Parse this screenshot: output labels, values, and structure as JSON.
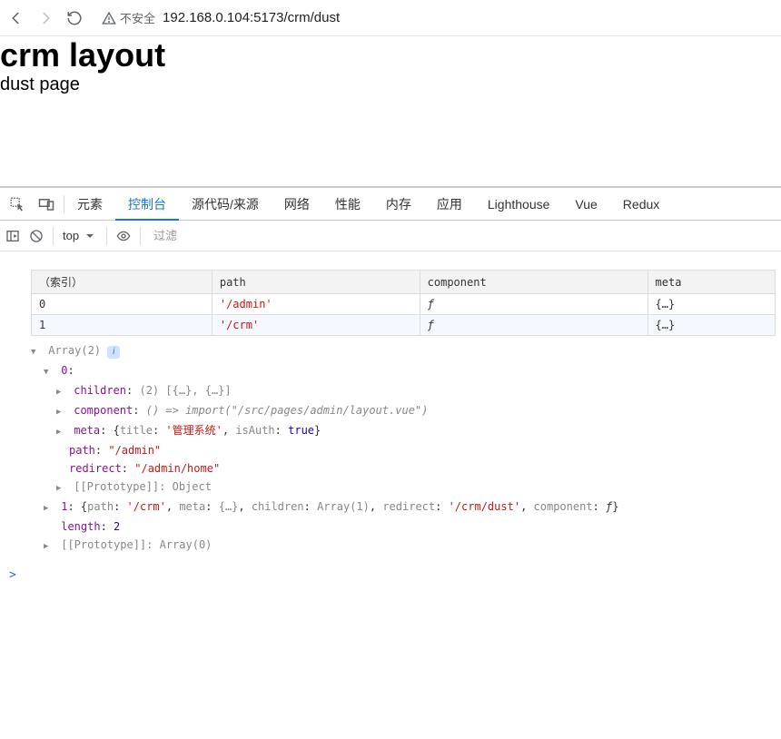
{
  "browser": {
    "not_secure_label": "不安全",
    "url": "192.168.0.104:5173/crm/dust"
  },
  "page": {
    "heading": "crm layout",
    "sub": "dust page"
  },
  "devtools": {
    "tabs": [
      "元素",
      "控制台",
      "源代码/来源",
      "网络",
      "性能",
      "内存",
      "应用",
      "Lighthouse",
      "Vue",
      "Redux"
    ],
    "active_tab_index": 1,
    "context": "top",
    "filter_placeholder": "过滤"
  },
  "table": {
    "headers": [
      "（索引）",
      "path",
      "component",
      "meta"
    ],
    "rows": [
      {
        "index": "0",
        "path": "'/admin'",
        "component": "ƒ",
        "meta": "{…}"
      },
      {
        "index": "1",
        "path": "'/crm'",
        "component": "ƒ",
        "meta": "{…}"
      }
    ]
  },
  "tree": {
    "root_label": "Array(2)",
    "node0": {
      "label": "0",
      "children_label": "children",
      "children_value": "(2) [{…}, {…}]",
      "component_label": "component",
      "component_value": "() => import(\"/src/pages/admin/layout.vue\")",
      "meta_label": "meta",
      "meta_title_key": "title",
      "meta_title_value": "'管理系统'",
      "meta_isauth_key": "isAuth",
      "meta_isauth_value": "true",
      "path_label": "path",
      "path_value": "\"/admin\"",
      "redirect_label": "redirect",
      "redirect_value": "\"/admin/home\"",
      "proto_label": "[[Prototype]]",
      "proto_value": "Object"
    },
    "node1": {
      "label": "1",
      "summary_path_k": "path",
      "summary_path_v": "'/crm'",
      "summary_meta_k": "meta",
      "summary_meta_v": "{…}",
      "summary_children_k": "children",
      "summary_children_v": "Array(1)",
      "summary_redirect_k": "redirect",
      "summary_redirect_v": "'/crm/dust'",
      "summary_component_k": "component",
      "summary_component_v": "ƒ"
    },
    "length_label": "length",
    "length_value": "2",
    "proto_label": "[[Prototype]]",
    "proto_value": "Array(0)"
  },
  "prompt": ">"
}
